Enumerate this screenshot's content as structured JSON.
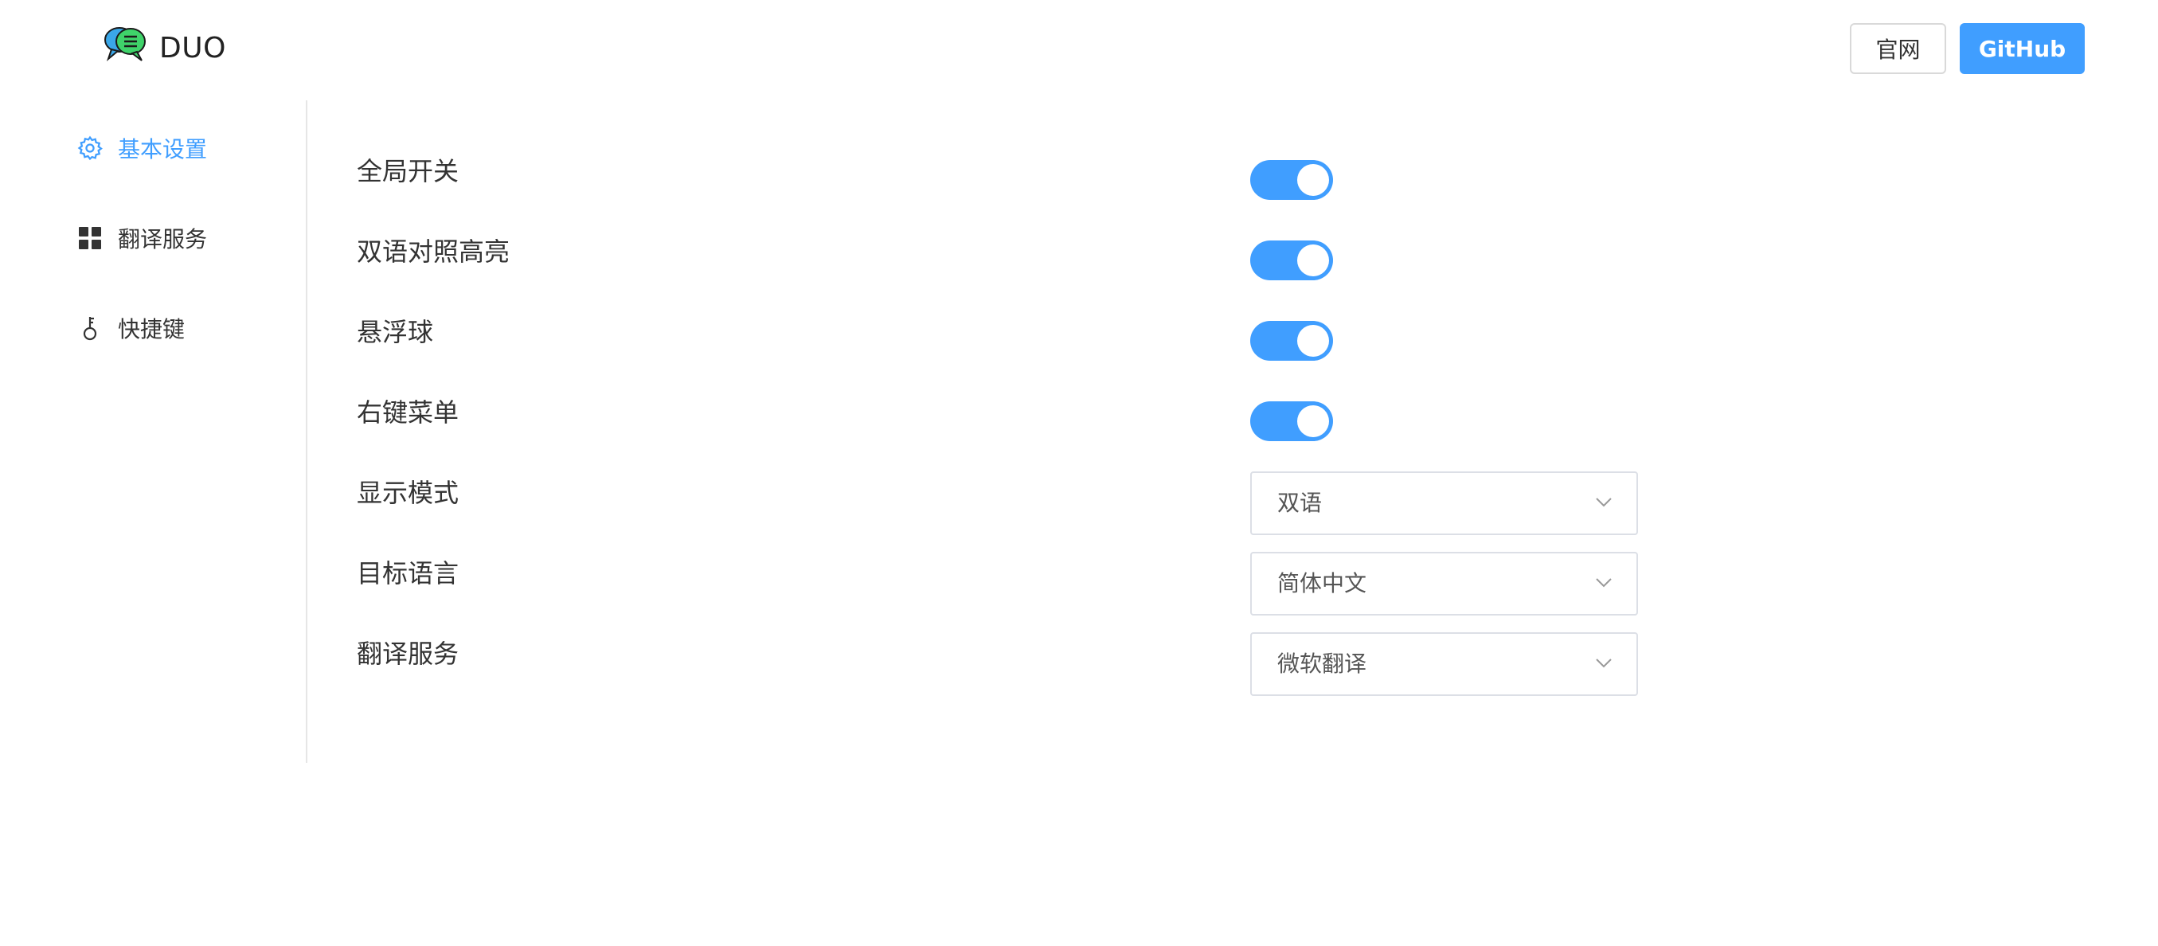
{
  "header": {
    "brand": "DUO",
    "buttons": {
      "official": "官网",
      "github": "GitHub"
    }
  },
  "sidebar": {
    "items": [
      {
        "label": "基本设置",
        "icon": "gear-icon",
        "active": true
      },
      {
        "label": "翻译服务",
        "icon": "grid-icon",
        "active": false
      },
      {
        "label": "快捷键",
        "icon": "key-icon",
        "active": false
      }
    ]
  },
  "settings": {
    "toggles": [
      {
        "label": "全局开关",
        "on": true
      },
      {
        "label": "双语对照高亮",
        "on": true
      },
      {
        "label": "悬浮球",
        "on": true
      },
      {
        "label": "右键菜单",
        "on": true
      }
    ],
    "selects": [
      {
        "label": "显示模式",
        "value": "双语"
      },
      {
        "label": "目标语言",
        "value": "简体中文"
      },
      {
        "label": "翻译服务",
        "value": "微软翻译"
      }
    ]
  },
  "colors": {
    "accent": "#409eff",
    "divider": "#e6e6e6",
    "border": "#dcdfe6"
  }
}
